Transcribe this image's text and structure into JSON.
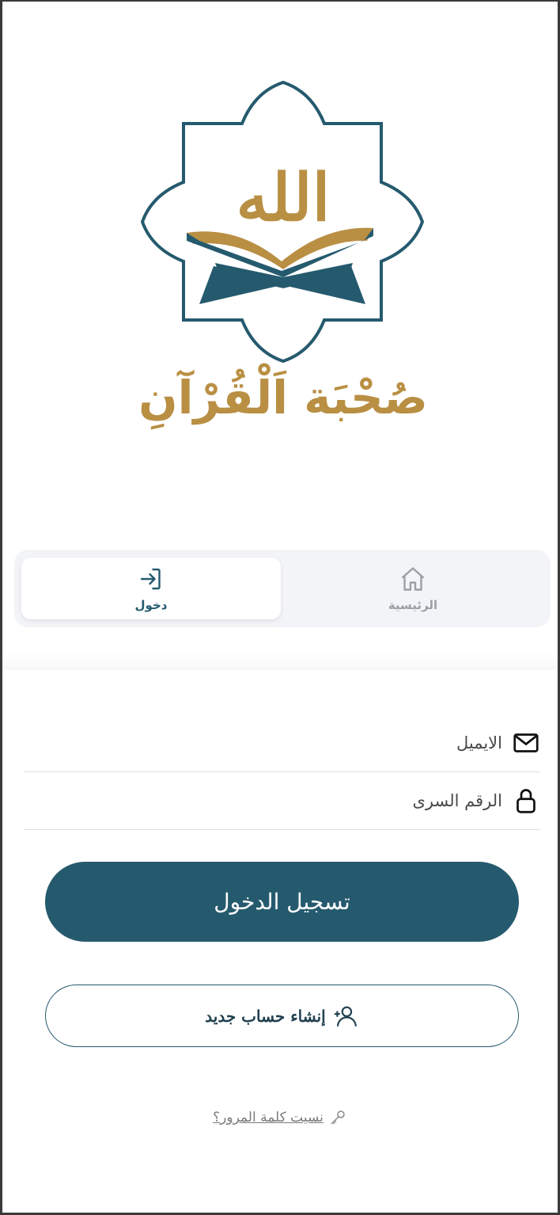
{
  "logo": {
    "allah_text": "الله",
    "app_name": "صُحْبَة اَلْقُرْآنِ"
  },
  "tabs": [
    {
      "label": "دخول",
      "icon": "login-icon",
      "active": true
    },
    {
      "label": "الرئيسية",
      "icon": "home-icon",
      "active": false
    }
  ],
  "form": {
    "email_placeholder": "الايميل",
    "email_value": "",
    "password_placeholder": "الرقم السرى",
    "password_value": ""
  },
  "buttons": {
    "login_label": "تسجيل الدخول",
    "register_label": "إنشاء حساب جديد",
    "forgot_label": "نسيت كلمة المرور؟"
  },
  "colors": {
    "primary": "#255a6e",
    "gold": "#b98f43",
    "tabbar_bg": "#f3f4f7"
  }
}
